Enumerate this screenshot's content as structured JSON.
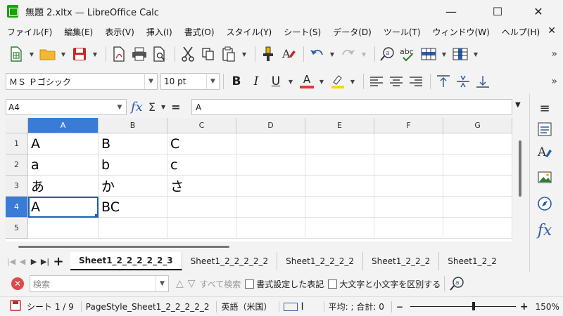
{
  "window": {
    "title": "無題 2.xltx — LibreOffice Calc",
    "minimize": "—",
    "maximize": "☐",
    "close": "✕"
  },
  "menu": {
    "items": [
      "ファイル(F)",
      "編集(E)",
      "表示(V)",
      "挿入(I)",
      "書式(O)",
      "スタイル(Y)",
      "シート(S)",
      "データ(D)",
      "ツール(T)",
      "ウィンドウ(W)",
      "ヘルプ(H)"
    ],
    "close": "✕"
  },
  "toolbar": {
    "overflow": "»"
  },
  "format": {
    "font_name": "ＭＳ Ｐゴシック",
    "font_size": "10 pt",
    "bold": "B",
    "italic": "I",
    "underline": "U",
    "font_color_icon": "A",
    "colors": {
      "font": "#e53935",
      "highlight": "#ffd600"
    }
  },
  "formula_bar": {
    "name_box": "A4",
    "fx": "fx",
    "sum": "Σ",
    "equals": "=",
    "content": "A"
  },
  "grid": {
    "columns": [
      "A",
      "B",
      "C",
      "D",
      "E",
      "F",
      "G"
    ],
    "rows": [
      "1",
      "2",
      "3",
      "4",
      "5"
    ],
    "selected_col": "A",
    "selected_row": "4",
    "cells": [
      [
        "A",
        "B",
        "C",
        "",
        "",
        "",
        ""
      ],
      [
        "a",
        "b",
        "c",
        "",
        "",
        "",
        ""
      ],
      [
        "あ",
        "か",
        "さ",
        "",
        "",
        "",
        ""
      ],
      [
        "A",
        "BC",
        "",
        "",
        "",
        "",
        ""
      ],
      [
        "",
        "",
        "",
        "",
        "",
        "",
        ""
      ]
    ],
    "active_cell": "A4"
  },
  "sheet_tabs": {
    "tabs": [
      "Sheet1_2_2_2_2_2_3",
      "Sheet1_2_2_2_2_2",
      "Sheet1_2_2_2_2",
      "Sheet1_2_2_2",
      "Sheet1_2_2"
    ],
    "active_index": 0,
    "add": "+"
  },
  "find": {
    "placeholder": "検索",
    "find_all": "すべて検索",
    "formatted_display": "書式設定した表記",
    "match_case": "大文字と小文字を区別する"
  },
  "status": {
    "sheet": "シート 1 / 9",
    "page_style": "PageStyle_Sheet1_2_2_2_2_2",
    "language": "英語（米国）",
    "summary": "平均: ; 合計: 0",
    "zoom_minus": "−",
    "zoom_plus": "+",
    "zoom": "150%"
  }
}
